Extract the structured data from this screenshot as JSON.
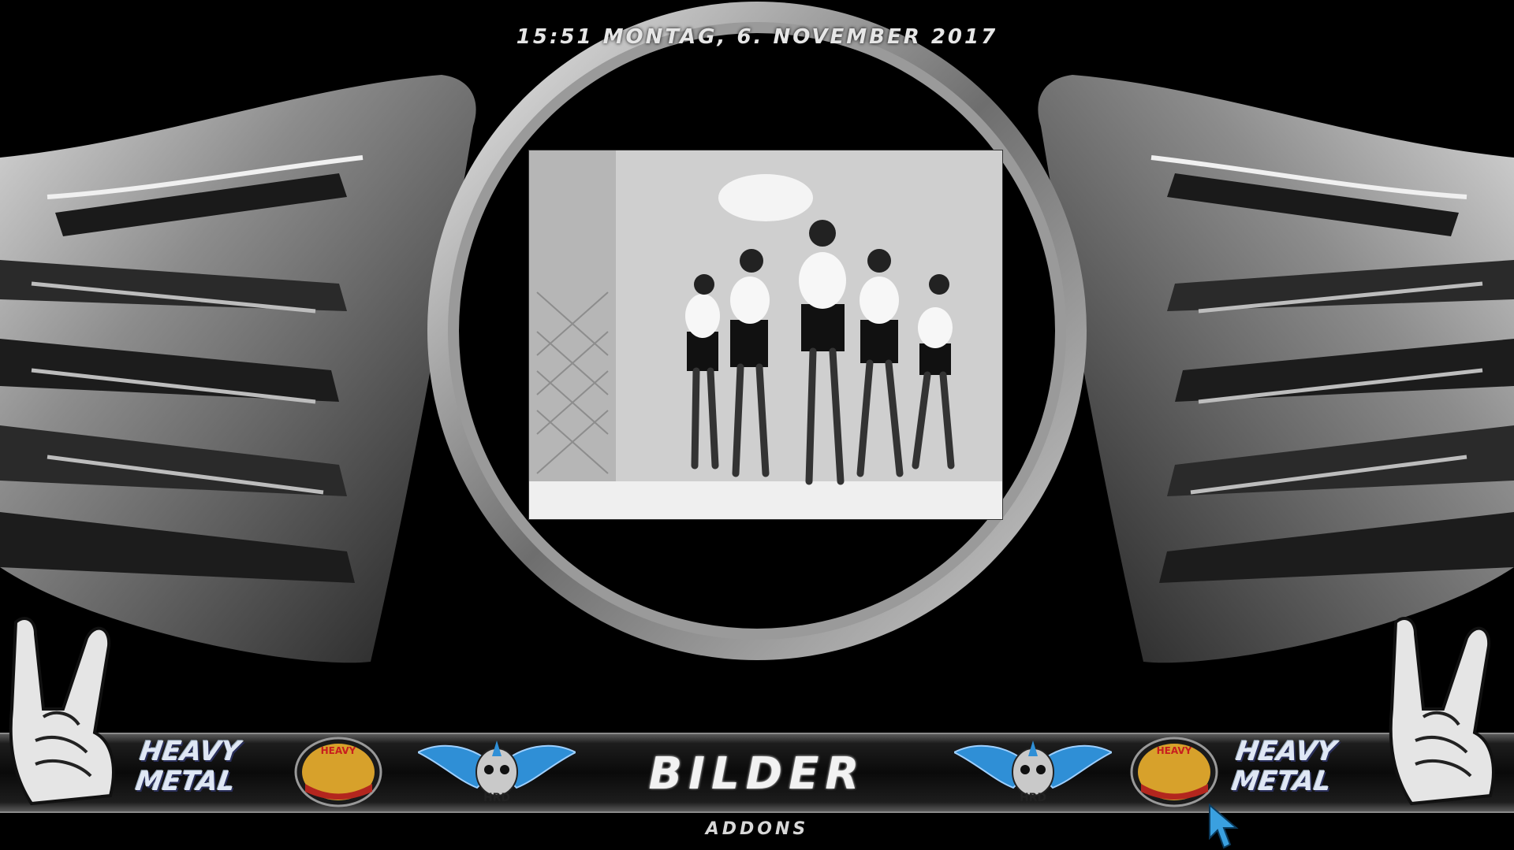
{
  "header": {
    "clock": "15:51  MONTAG, 6. NOVEMBER 2017"
  },
  "main_menu": {
    "active_item": "BILDER",
    "sub_item": "ADDONS"
  },
  "logos": {
    "heavy_metal_left": {
      "line1": "HEAVY",
      "line2": "METAL"
    },
    "heavy_metal_right": {
      "line1": "HEAVY",
      "line2": "METAL"
    },
    "badge_left": "HEAVY",
    "badge_right": "HEAVY",
    "skull_left": "HRD",
    "skull_right": "HRD"
  },
  "colors": {
    "background": "#000000",
    "chrome": "#b8b8b8",
    "wing_blue": "#2f8fd6",
    "cursor": "#3aa0e0"
  },
  "icons": [
    "rock-hand-icon",
    "wing-emblem",
    "skull-wings-icon",
    "mouse-cursor-icon"
  ]
}
